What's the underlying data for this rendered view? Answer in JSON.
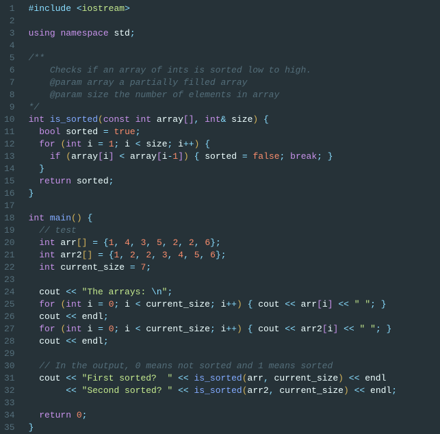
{
  "lines": [
    {
      "n": 1,
      "tokens": [
        [
          "inc",
          "#include "
        ],
        [
          "op",
          "<"
        ],
        [
          "incval",
          "iostream"
        ],
        [
          "op",
          ">"
        ]
      ]
    },
    {
      "n": 2,
      "tokens": []
    },
    {
      "n": 3,
      "tokens": [
        [
          "kw",
          "using"
        ],
        [
          "var",
          " "
        ],
        [
          "kw",
          "namespace"
        ],
        [
          "var",
          " std"
        ],
        [
          "punc",
          ";"
        ]
      ]
    },
    {
      "n": 4,
      "tokens": []
    },
    {
      "n": 5,
      "tokens": [
        [
          "com",
          "/**"
        ]
      ]
    },
    {
      "n": 6,
      "tokens": [
        [
          "com",
          "    Checks if an array of ints is sorted low to high."
        ]
      ]
    },
    {
      "n": 7,
      "tokens": [
        [
          "com",
          "    @param array a partially filled array"
        ]
      ]
    },
    {
      "n": 8,
      "tokens": [
        [
          "com",
          "    @param size the number of elements in array"
        ]
      ]
    },
    {
      "n": 9,
      "tokens": [
        [
          "com",
          "*/"
        ]
      ]
    },
    {
      "n": 10,
      "tokens": [
        [
          "type",
          "int"
        ],
        [
          "var",
          " "
        ],
        [
          "fn",
          "is_sorted"
        ],
        [
          "paren",
          "("
        ],
        [
          "kw",
          "const"
        ],
        [
          "var",
          " "
        ],
        [
          "type",
          "int"
        ],
        [
          "var",
          " array"
        ],
        [
          "paren2",
          "["
        ],
        [
          "paren2",
          "]"
        ],
        [
          "punc",
          ","
        ],
        [
          "var",
          " "
        ],
        [
          "type",
          "int"
        ],
        [
          "op",
          "&"
        ],
        [
          "var",
          " size"
        ],
        [
          "paren",
          ")"
        ],
        [
          "var",
          " "
        ],
        [
          "punc",
          "{"
        ]
      ]
    },
    {
      "n": 11,
      "tokens": [
        [
          "var",
          "  "
        ],
        [
          "type",
          "bool"
        ],
        [
          "var",
          " sorted "
        ],
        [
          "op",
          "="
        ],
        [
          "var",
          " "
        ],
        [
          "bool",
          "true"
        ],
        [
          "punc",
          ";"
        ]
      ]
    },
    {
      "n": 12,
      "tokens": [
        [
          "var",
          "  "
        ],
        [
          "kw",
          "for"
        ],
        [
          "var",
          " "
        ],
        [
          "paren",
          "("
        ],
        [
          "type",
          "int"
        ],
        [
          "var",
          " i "
        ],
        [
          "op",
          "="
        ],
        [
          "var",
          " "
        ],
        [
          "num",
          "1"
        ],
        [
          "punc",
          ";"
        ],
        [
          "var",
          " i "
        ],
        [
          "op",
          "<"
        ],
        [
          "var",
          " size"
        ],
        [
          "punc",
          ";"
        ],
        [
          "var",
          " i"
        ],
        [
          "op",
          "++"
        ],
        [
          "paren",
          ")"
        ],
        [
          "var",
          " "
        ],
        [
          "punc",
          "{"
        ]
      ]
    },
    {
      "n": 13,
      "tokens": [
        [
          "var",
          "    "
        ],
        [
          "kw",
          "if"
        ],
        [
          "var",
          " "
        ],
        [
          "paren",
          "("
        ],
        [
          "var",
          "array"
        ],
        [
          "paren2",
          "["
        ],
        [
          "var",
          "i"
        ],
        [
          "paren2",
          "]"
        ],
        [
          "var",
          " "
        ],
        [
          "op",
          "<"
        ],
        [
          "var",
          " array"
        ],
        [
          "paren2",
          "["
        ],
        [
          "var",
          "i"
        ],
        [
          "op",
          "-"
        ],
        [
          "num",
          "1"
        ],
        [
          "paren2",
          "]"
        ],
        [
          "paren",
          ")"
        ],
        [
          "var",
          " "
        ],
        [
          "punc",
          "{"
        ],
        [
          "var",
          " sorted "
        ],
        [
          "op",
          "="
        ],
        [
          "var",
          " "
        ],
        [
          "bool",
          "false"
        ],
        [
          "punc",
          ";"
        ],
        [
          "var",
          " "
        ],
        [
          "kw",
          "break"
        ],
        [
          "punc",
          ";"
        ],
        [
          "var",
          " "
        ],
        [
          "punc",
          "}"
        ]
      ]
    },
    {
      "n": 14,
      "tokens": [
        [
          "var",
          "  "
        ],
        [
          "punc",
          "}"
        ]
      ]
    },
    {
      "n": 15,
      "tokens": [
        [
          "var",
          "  "
        ],
        [
          "kw",
          "return"
        ],
        [
          "var",
          " sorted"
        ],
        [
          "punc",
          ";"
        ]
      ]
    },
    {
      "n": 16,
      "tokens": [
        [
          "punc",
          "}"
        ]
      ]
    },
    {
      "n": 17,
      "tokens": []
    },
    {
      "n": 18,
      "tokens": [
        [
          "type",
          "int"
        ],
        [
          "var",
          " "
        ],
        [
          "fn",
          "main"
        ],
        [
          "paren",
          "("
        ],
        [
          "paren",
          ")"
        ],
        [
          "var",
          " "
        ],
        [
          "punc",
          "{"
        ]
      ]
    },
    {
      "n": 19,
      "tokens": [
        [
          "var",
          "  "
        ],
        [
          "com",
          "// test"
        ]
      ]
    },
    {
      "n": 20,
      "tokens": [
        [
          "var",
          "  "
        ],
        [
          "type",
          "int"
        ],
        [
          "var",
          " arr"
        ],
        [
          "paren",
          "["
        ],
        [
          "paren",
          "]"
        ],
        [
          "var",
          " "
        ],
        [
          "op",
          "="
        ],
        [
          "var",
          " "
        ],
        [
          "punc",
          "{"
        ],
        [
          "num",
          "1"
        ],
        [
          "punc",
          ","
        ],
        [
          "var",
          " "
        ],
        [
          "num",
          "4"
        ],
        [
          "punc",
          ","
        ],
        [
          "var",
          " "
        ],
        [
          "num",
          "3"
        ],
        [
          "punc",
          ","
        ],
        [
          "var",
          " "
        ],
        [
          "num",
          "5"
        ],
        [
          "punc",
          ","
        ],
        [
          "var",
          " "
        ],
        [
          "num",
          "2"
        ],
        [
          "punc",
          ","
        ],
        [
          "var",
          " "
        ],
        [
          "num",
          "2"
        ],
        [
          "punc",
          ","
        ],
        [
          "var",
          " "
        ],
        [
          "num",
          "6"
        ],
        [
          "punc",
          "}"
        ],
        [
          "punc",
          ";"
        ]
      ]
    },
    {
      "n": 21,
      "tokens": [
        [
          "var",
          "  "
        ],
        [
          "type",
          "int"
        ],
        [
          "var",
          " arr2"
        ],
        [
          "paren",
          "["
        ],
        [
          "paren",
          "]"
        ],
        [
          "var",
          " "
        ],
        [
          "op",
          "="
        ],
        [
          "var",
          " "
        ],
        [
          "punc",
          "{"
        ],
        [
          "num",
          "1"
        ],
        [
          "punc",
          ","
        ],
        [
          "var",
          " "
        ],
        [
          "num",
          "2"
        ],
        [
          "punc",
          ","
        ],
        [
          "var",
          " "
        ],
        [
          "num",
          "2"
        ],
        [
          "punc",
          ","
        ],
        [
          "var",
          " "
        ],
        [
          "num",
          "3"
        ],
        [
          "punc",
          ","
        ],
        [
          "var",
          " "
        ],
        [
          "num",
          "4"
        ],
        [
          "punc",
          ","
        ],
        [
          "var",
          " "
        ],
        [
          "num",
          "5"
        ],
        [
          "punc",
          ","
        ],
        [
          "var",
          " "
        ],
        [
          "num",
          "6"
        ],
        [
          "punc",
          "}"
        ],
        [
          "punc",
          ";"
        ]
      ]
    },
    {
      "n": 22,
      "tokens": [
        [
          "var",
          "  "
        ],
        [
          "type",
          "int"
        ],
        [
          "var",
          " current_size "
        ],
        [
          "op",
          "="
        ],
        [
          "var",
          " "
        ],
        [
          "num",
          "7"
        ],
        [
          "punc",
          ";"
        ]
      ]
    },
    {
      "n": 23,
      "tokens": []
    },
    {
      "n": 24,
      "tokens": [
        [
          "var",
          "  cout "
        ],
        [
          "op",
          "<<"
        ],
        [
          "var",
          " "
        ],
        [
          "str",
          "\"The arrays: "
        ],
        [
          "esc",
          "\\n"
        ],
        [
          "str",
          "\""
        ],
        [
          "punc",
          ";"
        ]
      ]
    },
    {
      "n": 25,
      "tokens": [
        [
          "var",
          "  "
        ],
        [
          "kw",
          "for"
        ],
        [
          "var",
          " "
        ],
        [
          "paren",
          "("
        ],
        [
          "type",
          "int"
        ],
        [
          "var",
          " i "
        ],
        [
          "op",
          "="
        ],
        [
          "var",
          " "
        ],
        [
          "num",
          "0"
        ],
        [
          "punc",
          ";"
        ],
        [
          "var",
          " i "
        ],
        [
          "op",
          "<"
        ],
        [
          "var",
          " current_size"
        ],
        [
          "punc",
          ";"
        ],
        [
          "var",
          " i"
        ],
        [
          "op",
          "++"
        ],
        [
          "paren",
          ")"
        ],
        [
          "var",
          " "
        ],
        [
          "punc",
          "{"
        ],
        [
          "var",
          " cout "
        ],
        [
          "op",
          "<<"
        ],
        [
          "var",
          " arr"
        ],
        [
          "paren2",
          "["
        ],
        [
          "var",
          "i"
        ],
        [
          "paren2",
          "]"
        ],
        [
          "var",
          " "
        ],
        [
          "op",
          "<<"
        ],
        [
          "var",
          " "
        ],
        [
          "str",
          "\" \""
        ],
        [
          "punc",
          ";"
        ],
        [
          "var",
          " "
        ],
        [
          "punc",
          "}"
        ]
      ]
    },
    {
      "n": 26,
      "tokens": [
        [
          "var",
          "  cout "
        ],
        [
          "op",
          "<<"
        ],
        [
          "var",
          " endl"
        ],
        [
          "punc",
          ";"
        ]
      ]
    },
    {
      "n": 27,
      "tokens": [
        [
          "var",
          "  "
        ],
        [
          "kw",
          "for"
        ],
        [
          "var",
          " "
        ],
        [
          "paren",
          "("
        ],
        [
          "type",
          "int"
        ],
        [
          "var",
          " i "
        ],
        [
          "op",
          "="
        ],
        [
          "var",
          " "
        ],
        [
          "num",
          "0"
        ],
        [
          "punc",
          ";"
        ],
        [
          "var",
          " i "
        ],
        [
          "op",
          "<"
        ],
        [
          "var",
          " current_size"
        ],
        [
          "punc",
          ";"
        ],
        [
          "var",
          " i"
        ],
        [
          "op",
          "++"
        ],
        [
          "paren",
          ")"
        ],
        [
          "var",
          " "
        ],
        [
          "punc",
          "{"
        ],
        [
          "var",
          " cout "
        ],
        [
          "op",
          "<<"
        ],
        [
          "var",
          " arr2"
        ],
        [
          "paren2",
          "["
        ],
        [
          "var",
          "i"
        ],
        [
          "paren2",
          "]"
        ],
        [
          "var",
          " "
        ],
        [
          "op",
          "<<"
        ],
        [
          "var",
          " "
        ],
        [
          "str",
          "\" \""
        ],
        [
          "punc",
          ";"
        ],
        [
          "var",
          " "
        ],
        [
          "punc",
          "}"
        ]
      ]
    },
    {
      "n": 28,
      "tokens": [
        [
          "var",
          "  cout "
        ],
        [
          "op",
          "<<"
        ],
        [
          "var",
          " endl"
        ],
        [
          "punc",
          ";"
        ]
      ]
    },
    {
      "n": 29,
      "tokens": []
    },
    {
      "n": 30,
      "tokens": [
        [
          "var",
          "  "
        ],
        [
          "com",
          "// In the output, 0 means not sorted and 1 means sorted"
        ]
      ]
    },
    {
      "n": 31,
      "tokens": [
        [
          "var",
          "  cout "
        ],
        [
          "op",
          "<<"
        ],
        [
          "var",
          " "
        ],
        [
          "str",
          "\"First sorted?  \""
        ],
        [
          "var",
          " "
        ],
        [
          "op",
          "<<"
        ],
        [
          "var",
          " "
        ],
        [
          "fn",
          "is_sorted"
        ],
        [
          "paren",
          "("
        ],
        [
          "var",
          "arr"
        ],
        [
          "punc",
          ","
        ],
        [
          "var",
          " current_size"
        ],
        [
          "paren",
          ")"
        ],
        [
          "var",
          " "
        ],
        [
          "op",
          "<<"
        ],
        [
          "var",
          " endl"
        ]
      ]
    },
    {
      "n": 32,
      "tokens": [
        [
          "var",
          "       "
        ],
        [
          "op",
          "<<"
        ],
        [
          "var",
          " "
        ],
        [
          "str",
          "\"Second sorted? \""
        ],
        [
          "var",
          " "
        ],
        [
          "op",
          "<<"
        ],
        [
          "var",
          " "
        ],
        [
          "fn",
          "is_sorted"
        ],
        [
          "paren",
          "("
        ],
        [
          "var",
          "arr2"
        ],
        [
          "punc",
          ","
        ],
        [
          "var",
          " current_size"
        ],
        [
          "paren",
          ")"
        ],
        [
          "var",
          " "
        ],
        [
          "op",
          "<<"
        ],
        [
          "var",
          " endl"
        ],
        [
          "punc",
          ";"
        ]
      ]
    },
    {
      "n": 33,
      "tokens": []
    },
    {
      "n": 34,
      "tokens": [
        [
          "var",
          "  "
        ],
        [
          "kw",
          "return"
        ],
        [
          "var",
          " "
        ],
        [
          "num",
          "0"
        ],
        [
          "punc",
          ";"
        ]
      ]
    },
    {
      "n": 35,
      "tokens": [
        [
          "punc",
          "}"
        ]
      ]
    }
  ]
}
